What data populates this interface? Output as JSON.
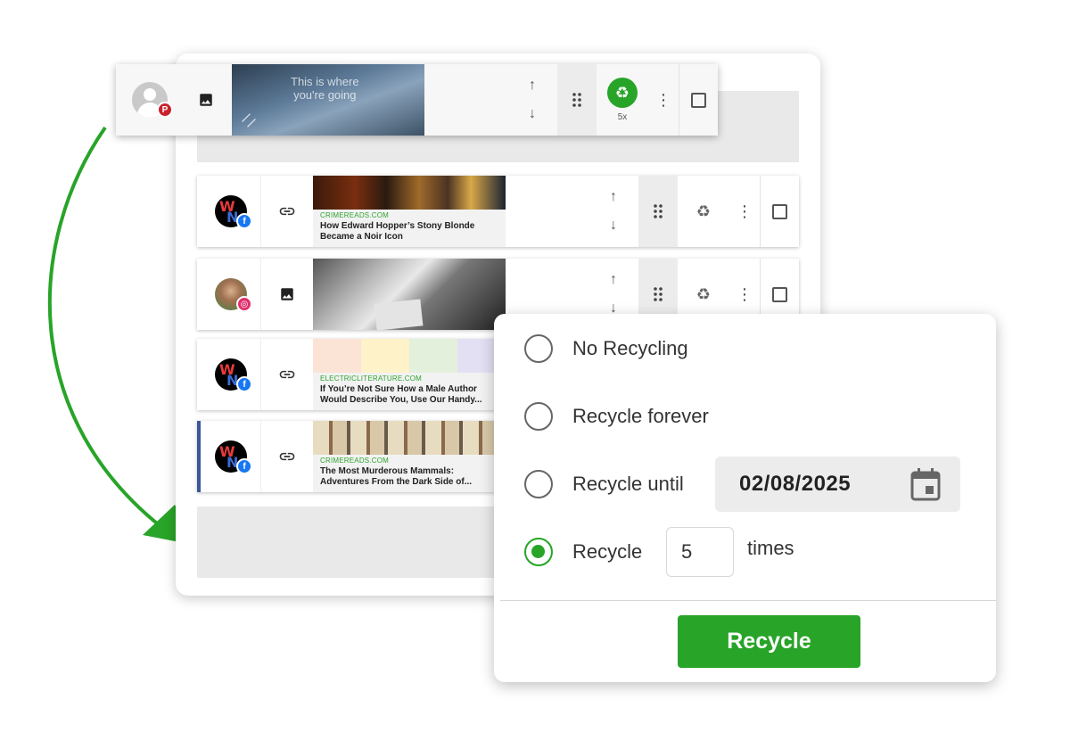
{
  "drag_card": {
    "network": "pinterest",
    "image_text_line1": "This is where",
    "image_text_line2": "you're going",
    "recycle_count": "5x"
  },
  "queue": {
    "items": [
      {
        "network": "facebook",
        "type": "link",
        "domain": "CRIMEREADS.COM",
        "title": "How Edward Hopper’s Stony Blonde Became a Noir Icon"
      },
      {
        "network": "instagram",
        "type": "image"
      },
      {
        "network": "facebook",
        "type": "link",
        "domain": "ELECTRICLITERATURE.COM",
        "title": "If You’re Not Sure How a Male Author Would Describe You, Use Our Handy..."
      },
      {
        "network": "facebook",
        "type": "link",
        "domain": "CRIMEREADS.COM",
        "title": "The Most Murderous Mammals: Adventures From the Dark Side of..."
      }
    ]
  },
  "recycle_popup": {
    "options": [
      {
        "label": "No Recycling",
        "checked": false
      },
      {
        "label": "Recycle forever",
        "checked": false
      },
      {
        "label": "Recycle until",
        "checked": false
      },
      {
        "label": "Recycle",
        "checked": true
      }
    ],
    "date_value": "02/08/2025",
    "times_value": "5",
    "times_suffix": "times",
    "button_label": "Recycle"
  },
  "colors": {
    "accent_green": "#28a428",
    "facebook_blue": "#1877f2",
    "selected_bar": "#3b5998"
  },
  "icons": [
    "avatar-placeholder",
    "image-icon",
    "link-icon",
    "arrow-up-icon",
    "arrow-down-icon",
    "drag-handle-icon",
    "recycle-icon",
    "more-vert-icon",
    "checkbox-icon",
    "calendar-icon",
    "curved-arrow"
  ]
}
